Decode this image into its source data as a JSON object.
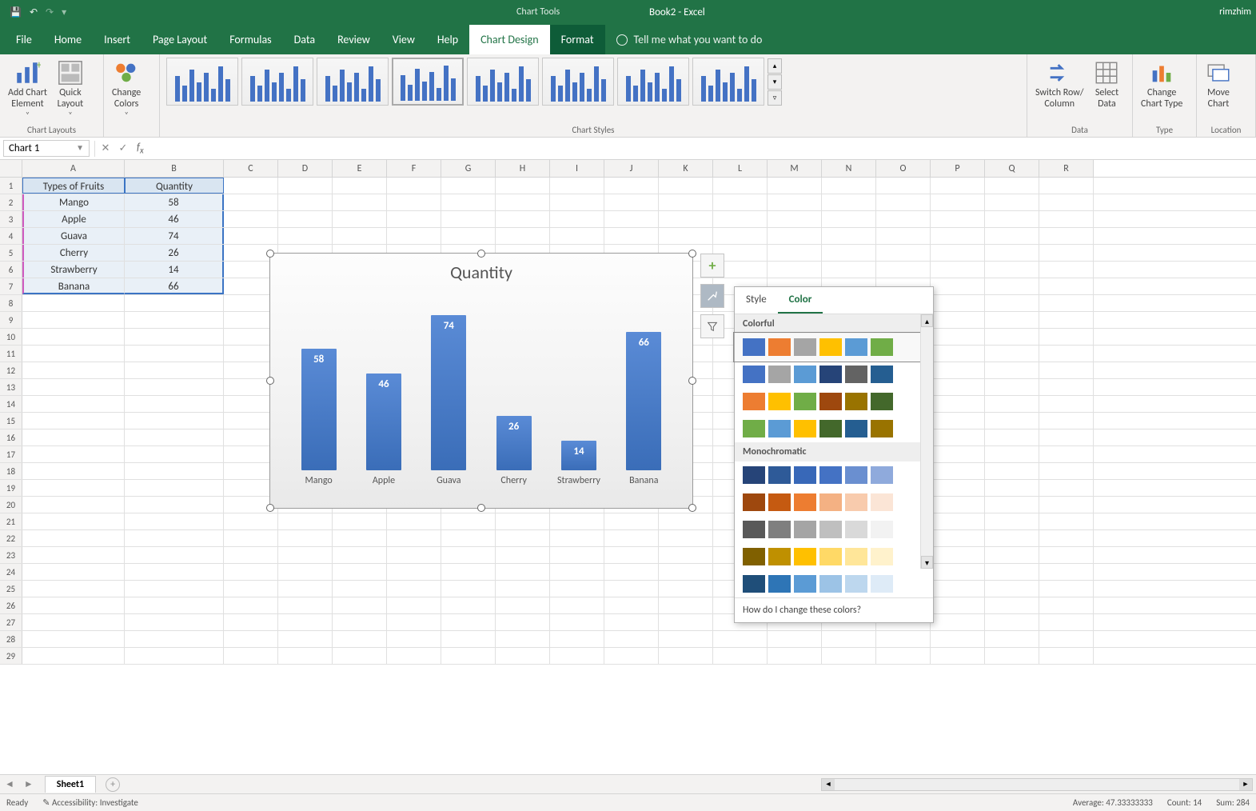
{
  "app": {
    "title_tool": "Chart Tools",
    "doc": "Book2  -  Excel",
    "user": "rimzhim"
  },
  "qat": {
    "save_icon": "save",
    "undo_icon": "undo",
    "redo_icon": "redo"
  },
  "tabs": {
    "file": "File",
    "home": "Home",
    "insert": "Insert",
    "pagelayout": "Page Layout",
    "formulas": "Formulas",
    "data": "Data",
    "review": "Review",
    "view": "View",
    "help": "Help",
    "design": "Chart Design",
    "format": "Format",
    "tellme": "Tell me what you want to do"
  },
  "ribbon": {
    "add_chart_element": "Add Chart\nElement",
    "quick_layout": "Quick\nLayout",
    "change_colors": "Change\nColors",
    "switch": "Switch Row/\nColumn",
    "select_data": "Select\nData",
    "change_type": "Change\nChart Type",
    "move_chart": "Move\nChart",
    "grp_layouts": "Chart Layouts",
    "grp_styles": "Chart Styles",
    "grp_data": "Data",
    "grp_type": "Type",
    "grp_location": "Location"
  },
  "namebox": "Chart 1",
  "columns": [
    "A",
    "B",
    "C",
    "D",
    "E",
    "F",
    "G",
    "H",
    "I",
    "J",
    "K",
    "L",
    "M",
    "N",
    "O",
    "P",
    "Q",
    "R"
  ],
  "grid": {
    "header": [
      "Types of Fruits",
      "Quantity"
    ],
    "rows": [
      [
        "Mango",
        "58"
      ],
      [
        "Apple",
        "46"
      ],
      [
        "Guava",
        "74"
      ],
      [
        "Cherry",
        "26"
      ],
      [
        "Strawberry",
        "14"
      ],
      [
        "Banana",
        "66"
      ]
    ],
    "row_numbers": 29
  },
  "chart_data": {
    "type": "bar",
    "title": "Quantity",
    "categories": [
      "Mango",
      "Apple",
      "Guava",
      "Cherry",
      "Strawberry",
      "Banana"
    ],
    "values": [
      58,
      46,
      74,
      26,
      14,
      66
    ],
    "ylim": [
      0,
      80
    ],
    "xlabel": "",
    "ylabel": ""
  },
  "flyout": {
    "style_tab": "Style",
    "color_tab": "Color",
    "colorful": "Colorful",
    "mono": "Monochromatic",
    "footer": "How do I change these colors?",
    "colorful_palettes": [
      [
        "#4472c4",
        "#ed7d31",
        "#a5a5a5",
        "#ffc000",
        "#5b9bd5",
        "#70ad47"
      ],
      [
        "#4472c4",
        "#a5a5a5",
        "#5b9bd5",
        "#264478",
        "#636363",
        "#255e91"
      ],
      [
        "#ed7d31",
        "#ffc000",
        "#70ad47",
        "#9e480e",
        "#997300",
        "#43682b"
      ],
      [
        "#70ad47",
        "#5b9bd5",
        "#ffc000",
        "#43682b",
        "#255e91",
        "#997300"
      ]
    ],
    "mono_palettes": [
      [
        "#264478",
        "#2e5a98",
        "#3868b8",
        "#4472c4",
        "#6a8fd0",
        "#8faadc"
      ],
      [
        "#9e480e",
        "#c55a11",
        "#ed7d31",
        "#f4b183",
        "#f8cbad",
        "#fbe5d6"
      ],
      [
        "#595959",
        "#7f7f7f",
        "#a5a5a5",
        "#bfbfbf",
        "#d9d9d9",
        "#f2f2f2"
      ],
      [
        "#806000",
        "#bf9000",
        "#ffc000",
        "#ffd966",
        "#ffe699",
        "#fff2cc"
      ],
      [
        "#1f4e79",
        "#2e75b6",
        "#5b9bd5",
        "#9cc3e6",
        "#bdd7ee",
        "#deebf7"
      ]
    ]
  },
  "sheet_tab": "Sheet1",
  "status": {
    "ready": "Ready",
    "acc": "Accessibility: Investigate",
    "avg": "Average: 47.33333333",
    "count": "Count: 14",
    "sum": "Sum: 284"
  }
}
